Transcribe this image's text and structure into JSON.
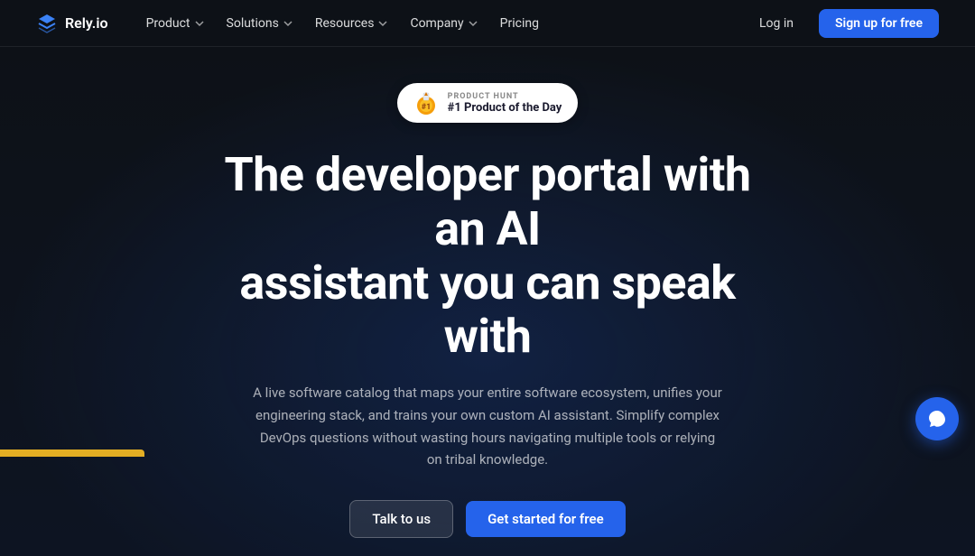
{
  "brand": {
    "name": "Rely.io",
    "logo_alt": "Rely.io logo"
  },
  "nav": {
    "items": [
      {
        "label": "Product",
        "has_dropdown": true
      },
      {
        "label": "Solutions",
        "has_dropdown": true
      },
      {
        "label": "Resources",
        "has_dropdown": true
      },
      {
        "label": "Company",
        "has_dropdown": true
      },
      {
        "label": "Pricing",
        "has_dropdown": false
      }
    ],
    "login_label": "Log in",
    "signup_label": "Sign up for free"
  },
  "hero": {
    "badge": {
      "top_label": "PRODUCT HUNT",
      "main_label": "#1 Product of the Day"
    },
    "title_line1": "The developer portal with an AI",
    "title_line2": "assistant you can speak with",
    "subtitle": "A live software catalog that maps your entire software ecosystem, unifies your engineering stack, and trains your own custom AI assistant. Simplify complex DevOps questions without wasting hours navigating multiple tools or relying on tribal knowledge.",
    "btn_talk": "Talk to us",
    "btn_started": "Get started for free"
  },
  "chat": {
    "icon": "💬"
  }
}
